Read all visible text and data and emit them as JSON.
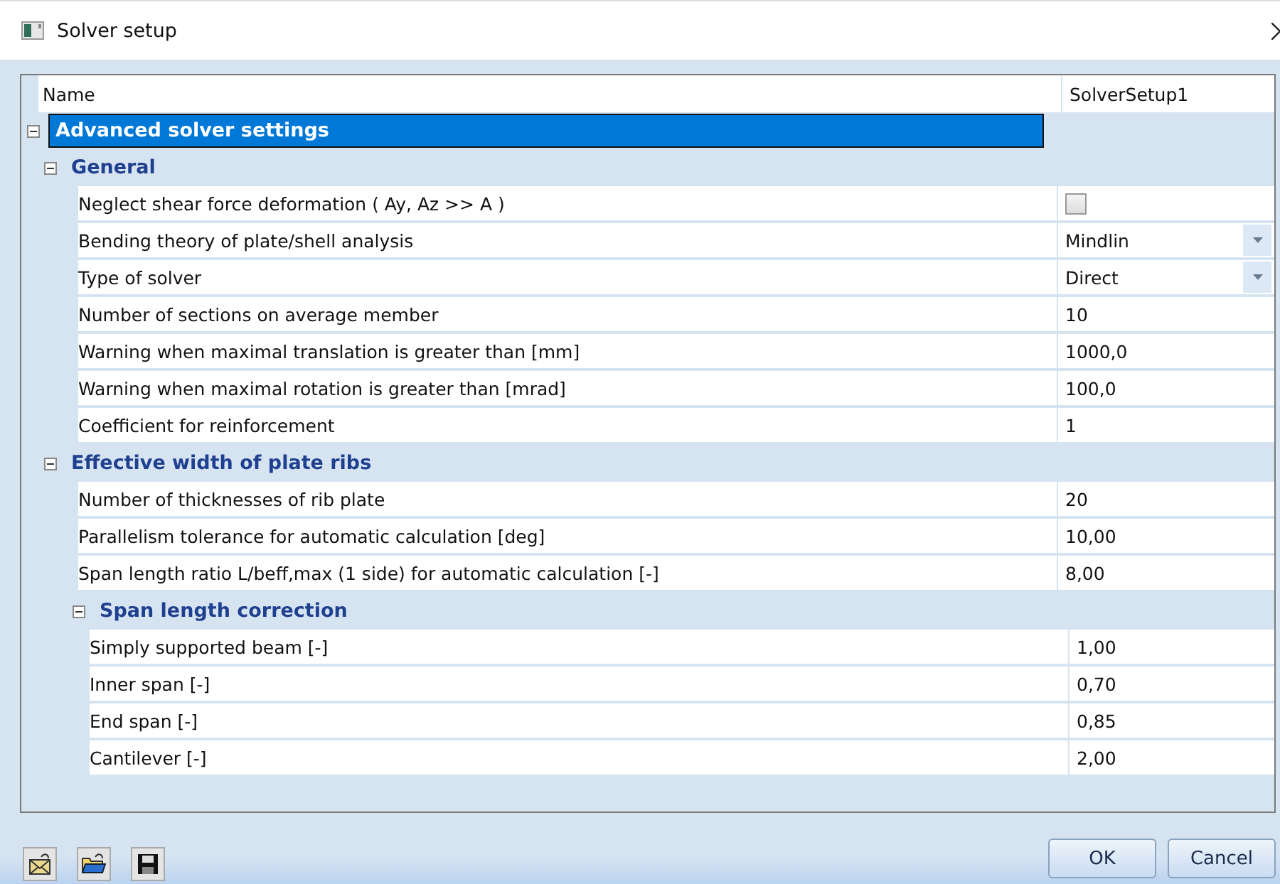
{
  "window": {
    "title": "Solver setup"
  },
  "table": {
    "columns": [
      "Name",
      "SolverSetup1"
    ],
    "tree": [
      {
        "label": "Advanced solver settings",
        "selected": true,
        "expanded": true,
        "children": [
          {
            "label": "General",
            "selected": false,
            "expanded": true,
            "children": [
              {
                "kind": "checkbox",
                "label": "Neglect shear force deformation ( Ay, Az >> A )",
                "checked": false
              },
              {
                "kind": "dropdown",
                "label": "Bending theory of plate/shell analysis",
                "value": "Mindlin"
              },
              {
                "kind": "dropdown",
                "label": "Type of solver",
                "value": "Direct"
              },
              {
                "kind": "text",
                "label": "Number of sections on average member",
                "value": "10"
              },
              {
                "kind": "text",
                "label": "Warning when maximal translation is greater than [mm]",
                "value": "1000,0"
              },
              {
                "kind": "text",
                "label": "Warning when maximal rotation is greater than [mrad]",
                "value": "100,0"
              },
              {
                "kind": "text",
                "label": "Coefficient for reinforcement",
                "value": "1"
              }
            ]
          },
          {
            "label": "Effective width of plate ribs",
            "selected": false,
            "expanded": true,
            "children": [
              {
                "kind": "text",
                "label": "Number of thicknesses of rib plate",
                "value": "20"
              },
              {
                "kind": "text",
                "label": "Parallelism tolerance for automatic calculation [deg]",
                "value": "10,00"
              },
              {
                "kind": "text",
                "label": "Span length ratio L/beff,max (1 side) for automatic calculation [-]",
                "value": "8,00"
              },
              {
                "label": "Span length correction",
                "selected": false,
                "expanded": true,
                "children": [
                  {
                    "kind": "text",
                    "label": "Simply supported beam [-]",
                    "value": "1,00"
                  },
                  {
                    "kind": "text",
                    "label": "Inner span [-]",
                    "value": "0,70"
                  },
                  {
                    "kind": "text",
                    "label": "End span [-]",
                    "value": "0,85"
                  },
                  {
                    "kind": "text",
                    "label": "Cantilever [-]",
                    "value": "2,00"
                  }
                ]
              }
            ]
          }
        ]
      }
    ]
  },
  "buttons": [
    "OK",
    "Cancel"
  ]
}
